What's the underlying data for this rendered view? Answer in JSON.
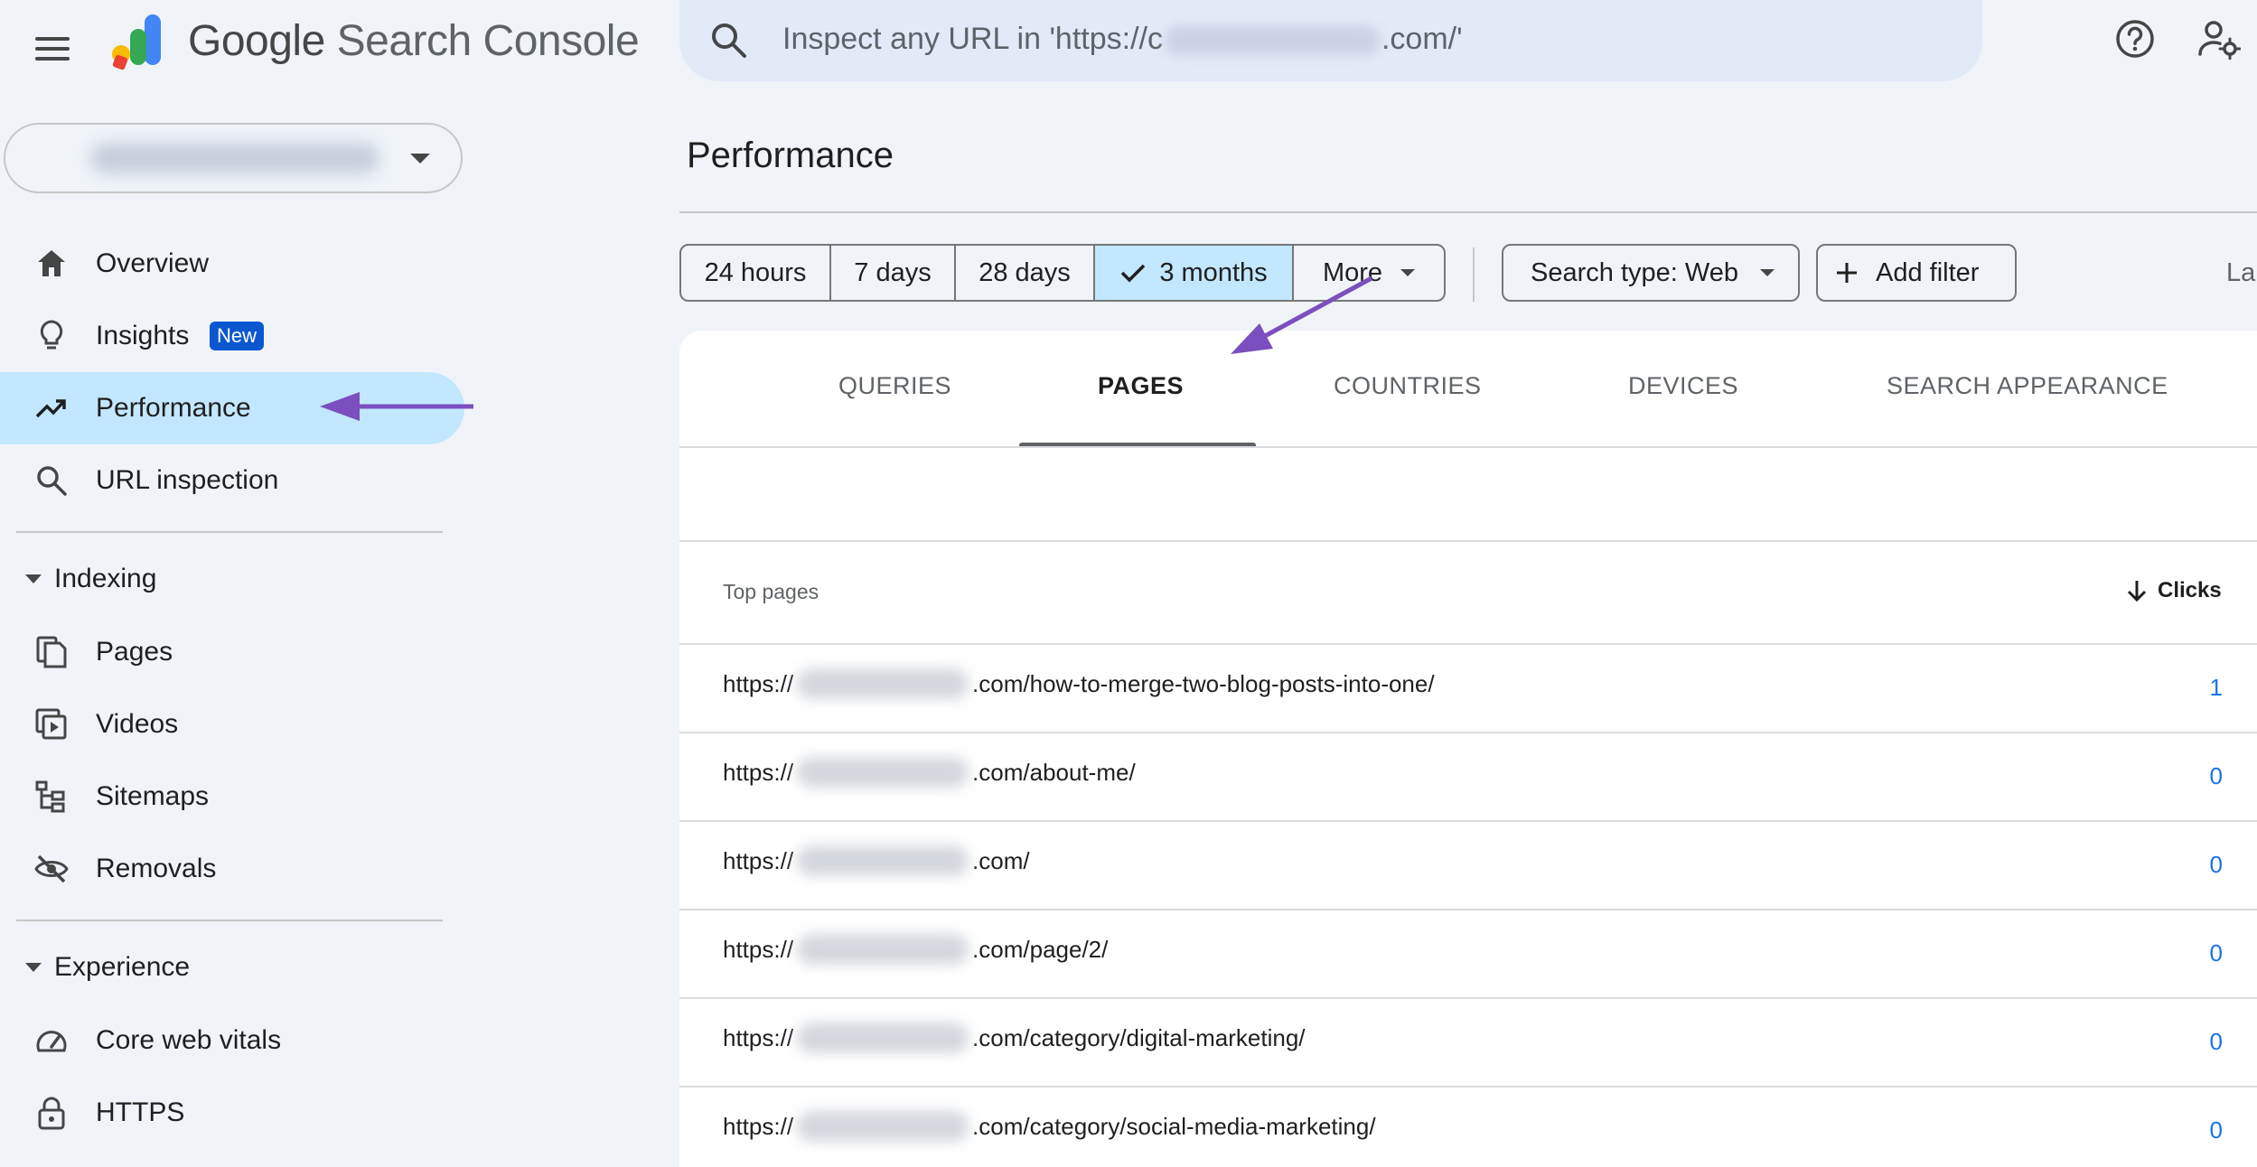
{
  "header": {
    "brand_google": "Google",
    "brand_product": "Search Console",
    "search_placeholder_prefix": "Inspect any URL in 'https://c",
    "search_placeholder_suffix": ".com/'"
  },
  "sidebar": {
    "items": [
      {
        "label": "Overview",
        "icon": "home-icon"
      },
      {
        "label": "Insights",
        "icon": "lightbulb-icon",
        "badge": "New"
      },
      {
        "label": "Performance",
        "icon": "trending-up-icon",
        "active": true
      },
      {
        "label": "URL inspection",
        "icon": "search-icon"
      }
    ],
    "indexing": {
      "title": "Indexing",
      "items": [
        {
          "label": "Pages",
          "icon": "pages-icon"
        },
        {
          "label": "Videos",
          "icon": "video-icon"
        },
        {
          "label": "Sitemaps",
          "icon": "sitemap-icon"
        },
        {
          "label": "Removals",
          "icon": "eye-off-icon"
        }
      ]
    },
    "experience": {
      "title": "Experience",
      "items": [
        {
          "label": "Core web vitals",
          "icon": "gauge-icon"
        },
        {
          "label": "HTTPS",
          "icon": "lock-icon"
        }
      ]
    }
  },
  "main": {
    "title": "Performance",
    "date_ranges": [
      "24 hours",
      "7 days",
      "28 days",
      "3 months",
      "More"
    ],
    "selected_range": "3 months",
    "search_type": "Search type: Web",
    "add_filter": "Add filter",
    "last_updated_partial": "La",
    "tabs": [
      "QUERIES",
      "PAGES",
      "COUNTRIES",
      "DEVICES",
      "SEARCH APPEARANCE"
    ],
    "active_tab": "PAGES",
    "table": {
      "label": "Top pages",
      "sort_column": "Clicks",
      "rows": [
        {
          "prefix": "https://",
          "path": ".com/how-to-merge-two-blog-posts-into-one/",
          "clicks": "1"
        },
        {
          "prefix": "https://",
          "path": ".com/about-me/",
          "clicks": "0"
        },
        {
          "prefix": "https://",
          "path": ".com/",
          "clicks": "0"
        },
        {
          "prefix": "https://",
          "path": ".com/page/2/",
          "clicks": "0"
        },
        {
          "prefix": "https://",
          "path": ".com/category/digital-marketing/",
          "clicks": "0"
        },
        {
          "prefix": "https://",
          "path": ".com/category/social-media-marketing/",
          "clicks": "0"
        }
      ]
    }
  },
  "colors": {
    "accent": "#1a73e8",
    "active_bg": "#c2e7ff",
    "annotation_arrow": "#7b4fbf"
  }
}
